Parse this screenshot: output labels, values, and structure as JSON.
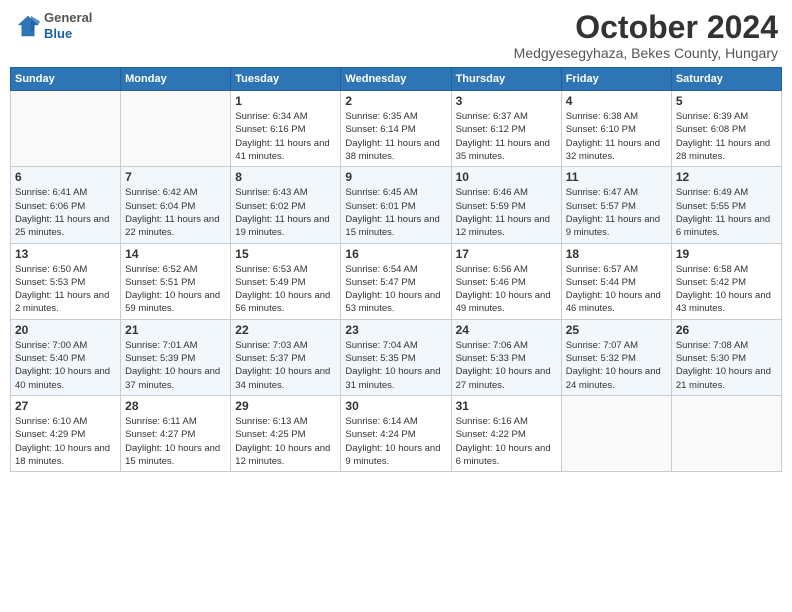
{
  "header": {
    "logo_general": "General",
    "logo_blue": "Blue",
    "month": "October 2024",
    "location": "Medgyesegyhaza, Bekes County, Hungary"
  },
  "days_of_week": [
    "Sunday",
    "Monday",
    "Tuesday",
    "Wednesday",
    "Thursday",
    "Friday",
    "Saturday"
  ],
  "weeks": [
    [
      {
        "day": "",
        "detail": ""
      },
      {
        "day": "",
        "detail": ""
      },
      {
        "day": "1",
        "detail": "Sunrise: 6:34 AM\nSunset: 6:16 PM\nDaylight: 11 hours and 41 minutes."
      },
      {
        "day": "2",
        "detail": "Sunrise: 6:35 AM\nSunset: 6:14 PM\nDaylight: 11 hours and 38 minutes."
      },
      {
        "day": "3",
        "detail": "Sunrise: 6:37 AM\nSunset: 6:12 PM\nDaylight: 11 hours and 35 minutes."
      },
      {
        "day": "4",
        "detail": "Sunrise: 6:38 AM\nSunset: 6:10 PM\nDaylight: 11 hours and 32 minutes."
      },
      {
        "day": "5",
        "detail": "Sunrise: 6:39 AM\nSunset: 6:08 PM\nDaylight: 11 hours and 28 minutes."
      }
    ],
    [
      {
        "day": "6",
        "detail": "Sunrise: 6:41 AM\nSunset: 6:06 PM\nDaylight: 11 hours and 25 minutes."
      },
      {
        "day": "7",
        "detail": "Sunrise: 6:42 AM\nSunset: 6:04 PM\nDaylight: 11 hours and 22 minutes."
      },
      {
        "day": "8",
        "detail": "Sunrise: 6:43 AM\nSunset: 6:02 PM\nDaylight: 11 hours and 19 minutes."
      },
      {
        "day": "9",
        "detail": "Sunrise: 6:45 AM\nSunset: 6:01 PM\nDaylight: 11 hours and 15 minutes."
      },
      {
        "day": "10",
        "detail": "Sunrise: 6:46 AM\nSunset: 5:59 PM\nDaylight: 11 hours and 12 minutes."
      },
      {
        "day": "11",
        "detail": "Sunrise: 6:47 AM\nSunset: 5:57 PM\nDaylight: 11 hours and 9 minutes."
      },
      {
        "day": "12",
        "detail": "Sunrise: 6:49 AM\nSunset: 5:55 PM\nDaylight: 11 hours and 6 minutes."
      }
    ],
    [
      {
        "day": "13",
        "detail": "Sunrise: 6:50 AM\nSunset: 5:53 PM\nDaylight: 11 hours and 2 minutes."
      },
      {
        "day": "14",
        "detail": "Sunrise: 6:52 AM\nSunset: 5:51 PM\nDaylight: 10 hours and 59 minutes."
      },
      {
        "day": "15",
        "detail": "Sunrise: 6:53 AM\nSunset: 5:49 PM\nDaylight: 10 hours and 56 minutes."
      },
      {
        "day": "16",
        "detail": "Sunrise: 6:54 AM\nSunset: 5:47 PM\nDaylight: 10 hours and 53 minutes."
      },
      {
        "day": "17",
        "detail": "Sunrise: 6:56 AM\nSunset: 5:46 PM\nDaylight: 10 hours and 49 minutes."
      },
      {
        "day": "18",
        "detail": "Sunrise: 6:57 AM\nSunset: 5:44 PM\nDaylight: 10 hours and 46 minutes."
      },
      {
        "day": "19",
        "detail": "Sunrise: 6:58 AM\nSunset: 5:42 PM\nDaylight: 10 hours and 43 minutes."
      }
    ],
    [
      {
        "day": "20",
        "detail": "Sunrise: 7:00 AM\nSunset: 5:40 PM\nDaylight: 10 hours and 40 minutes."
      },
      {
        "day": "21",
        "detail": "Sunrise: 7:01 AM\nSunset: 5:39 PM\nDaylight: 10 hours and 37 minutes."
      },
      {
        "day": "22",
        "detail": "Sunrise: 7:03 AM\nSunset: 5:37 PM\nDaylight: 10 hours and 34 minutes."
      },
      {
        "day": "23",
        "detail": "Sunrise: 7:04 AM\nSunset: 5:35 PM\nDaylight: 10 hours and 31 minutes."
      },
      {
        "day": "24",
        "detail": "Sunrise: 7:06 AM\nSunset: 5:33 PM\nDaylight: 10 hours and 27 minutes."
      },
      {
        "day": "25",
        "detail": "Sunrise: 7:07 AM\nSunset: 5:32 PM\nDaylight: 10 hours and 24 minutes."
      },
      {
        "day": "26",
        "detail": "Sunrise: 7:08 AM\nSunset: 5:30 PM\nDaylight: 10 hours and 21 minutes."
      }
    ],
    [
      {
        "day": "27",
        "detail": "Sunrise: 6:10 AM\nSunset: 4:29 PM\nDaylight: 10 hours and 18 minutes."
      },
      {
        "day": "28",
        "detail": "Sunrise: 6:11 AM\nSunset: 4:27 PM\nDaylight: 10 hours and 15 minutes."
      },
      {
        "day": "29",
        "detail": "Sunrise: 6:13 AM\nSunset: 4:25 PM\nDaylight: 10 hours and 12 minutes."
      },
      {
        "day": "30",
        "detail": "Sunrise: 6:14 AM\nSunset: 4:24 PM\nDaylight: 10 hours and 9 minutes."
      },
      {
        "day": "31",
        "detail": "Sunrise: 6:16 AM\nSunset: 4:22 PM\nDaylight: 10 hours and 6 minutes."
      },
      {
        "day": "",
        "detail": ""
      },
      {
        "day": "",
        "detail": ""
      }
    ]
  ]
}
